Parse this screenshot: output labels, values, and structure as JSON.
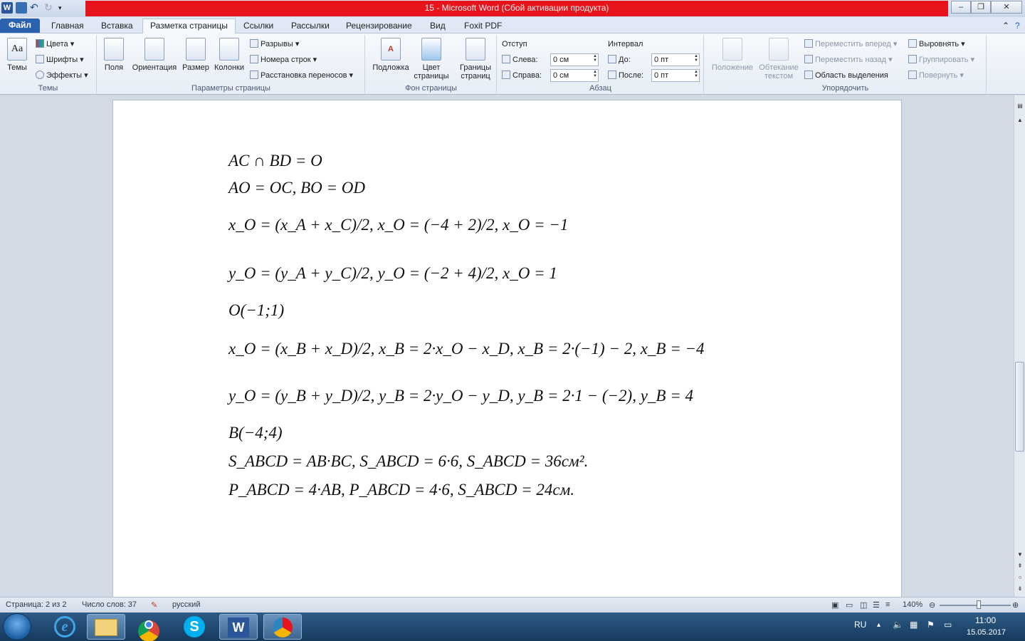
{
  "window": {
    "title": "15  -  Microsoft Word (Сбой активации продукта)",
    "controls": [
      "–",
      "❐",
      "✕"
    ]
  },
  "qat": {
    "word_icon": "word-icon",
    "undo_icon": "undo-icon",
    "redo_icon": "redo-icon"
  },
  "tabs": {
    "file": "Файл",
    "items": [
      "Главная",
      "Вставка",
      "Разметка страницы",
      "Ссылки",
      "Рассылки",
      "Рецензирование",
      "Вид",
      "Foxit PDF"
    ],
    "active": "Разметка страницы"
  },
  "ribbon": {
    "themes": {
      "label": "Темы",
      "themes_btn": "Темы",
      "colors": "Цвета",
      "fonts": "Шрифты",
      "effects": "Эффекты"
    },
    "page_setup": {
      "label": "Параметры страницы",
      "margins": "Поля",
      "orientation": "Ориентация",
      "size": "Размер",
      "columns": "Колонки",
      "breaks": "Разрывы",
      "line_numbers": "Номера строк",
      "hyphenation": "Расстановка переносов"
    },
    "page_background": {
      "label": "Фон страницы",
      "watermark": "Подложка",
      "page_color_1": "Цвет",
      "page_color_2": "страницы",
      "page_borders_1": "Границы",
      "page_borders_2": "страниц"
    },
    "paragraph": {
      "label": "Абзац",
      "indent_title": "Отступ",
      "left_label": "Слева:",
      "left_value": "0 см",
      "right_label": "Справа:",
      "right_value": "0 см",
      "spacing_title": "Интервал",
      "before_label": "До:",
      "before_value": "0 пт",
      "after_label": "После:",
      "after_value": "0 пт"
    },
    "arrange": {
      "label": "Упорядочить",
      "position": "Положение",
      "wrap_1": "Обтекание",
      "wrap_2": "текстом",
      "bring_forward": "Переместить вперед",
      "send_backward": "Переместить назад",
      "selection_pane": "Область выделения",
      "align": "Выровнять",
      "group": "Группировать",
      "rotate": "Повернуть"
    }
  },
  "document": {
    "lines": [
      "AC ∩ BD = O",
      "AO = OC,    BO = OD",
      "x_O = (x_A + x_C)/2,   x_O = (−4 + 2)/2,   x_O = −1",
      "y_O = (y_A + y_C)/2,   y_O = (−2 + 4)/2,   x_O = 1",
      "O(−1;1)",
      "x_O = (x_B + x_D)/2,   x_B = 2·x_O − x_D,   x_B = 2·(−1) − 2,   x_B = −4",
      "y_O = (y_B + y_D)/2,   y_B = 2·y_O − y_D,   y_B = 2·1 − (−2),   y_B = 4",
      "B(−4;4)",
      "S_ABCD = AB·BC,   S_ABCD = 6·6,   S_ABCD = 36см².",
      "P_ABCD = 4·AB,   P_ABCD = 4·6,   S_ABCD = 24см."
    ]
  },
  "status": {
    "page": "Страница: 2 из 2",
    "words": "Число слов: 37",
    "language": "русский",
    "zoom": "140%",
    "zoom_level": 0.55
  },
  "taskbar": {
    "apps": [
      "explorer-icon",
      "ie-icon",
      "folder-icon",
      "chrome-icon",
      "skype-icon",
      "word-icon",
      "app-icon"
    ],
    "lang": "RU",
    "time": "11:00",
    "date": "15.05.2017"
  }
}
